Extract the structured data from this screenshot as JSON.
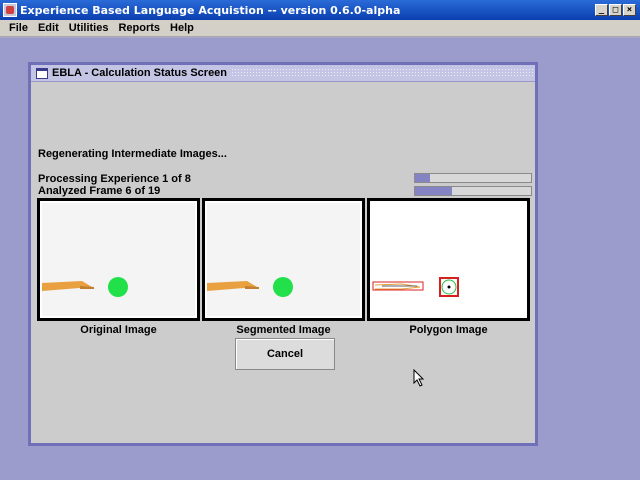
{
  "window": {
    "title": "Experience Based Language Acquistion -- version 0.6.0-alpha",
    "buttons": {
      "minimize": "_",
      "maximize": "□",
      "close": "×"
    }
  },
  "menu": [
    "File",
    "Edit",
    "Utilities",
    "Reports",
    "Help"
  ],
  "frame": {
    "title": "EBLA - Calculation Status Screen",
    "status": "Regenerating Intermediate Images...",
    "experience_progress": {
      "label": "Processing Experience 1 of 8",
      "fraction": 0.125
    },
    "frame_progress": {
      "label": "Analyzed Frame 6 of 19",
      "fraction": 0.316
    },
    "images": [
      {
        "caption": "Original Image"
      },
      {
        "caption": "Segmented Image"
      },
      {
        "caption": "Polygon Image"
      }
    ],
    "cancel_label": "Cancel"
  },
  "colors": {
    "accent": "#7070b8",
    "progress_fill": "#8484c4",
    "object_green": "#22e04a",
    "object_orange": "#e8a040",
    "polygon_red": "#d82020"
  }
}
